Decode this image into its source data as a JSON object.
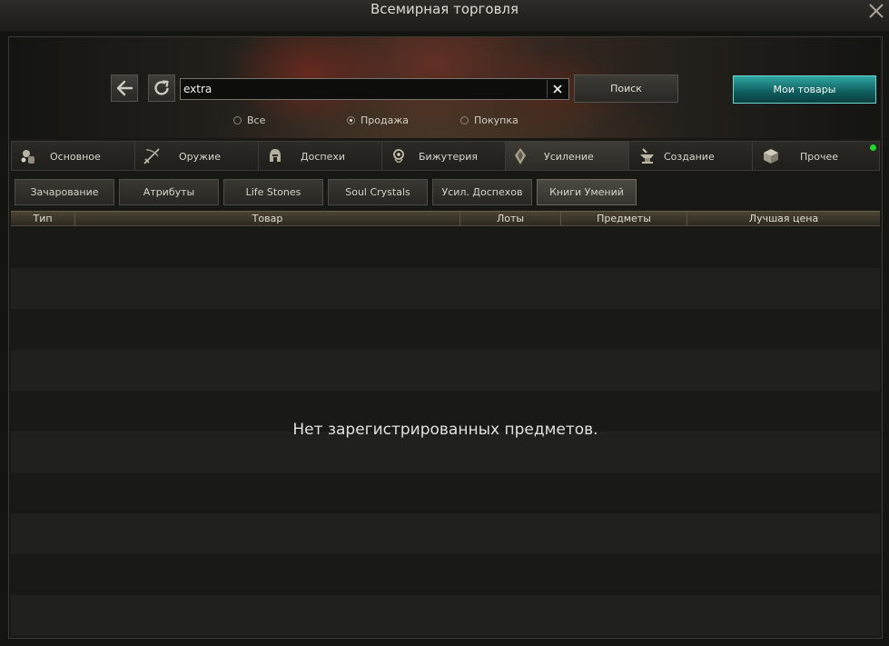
{
  "window": {
    "title": "Всемирная торговля"
  },
  "search": {
    "value": "extra",
    "button_label": "Поиск"
  },
  "my_goods_label": "Мои товары",
  "filters": [
    {
      "label": "Все",
      "selected": false
    },
    {
      "label": "Продажа",
      "selected": true
    },
    {
      "label": "Покупка",
      "selected": false
    }
  ],
  "categories": [
    {
      "label": "Основное",
      "icon": "basic-items-icon"
    },
    {
      "label": "Оружие",
      "icon": "weapon-icon"
    },
    {
      "label": "Доспехи",
      "icon": "armor-helmet-icon"
    },
    {
      "label": "Бижутерия",
      "icon": "jewelry-icon"
    },
    {
      "label": "Усиление",
      "icon": "enhancement-crystal-icon",
      "active": true
    },
    {
      "label": "Создание",
      "icon": "crafting-anvil-icon"
    },
    {
      "label": "Прочее",
      "icon": "misc-box-icon"
    }
  ],
  "subcategories": [
    {
      "label": "Зачарование"
    },
    {
      "label": "Атрибуты"
    },
    {
      "label": "Life Stones"
    },
    {
      "label": "Soul Crystals"
    },
    {
      "label": "Усил. Доспехов"
    },
    {
      "label": "Книги Умений",
      "active": true
    }
  ],
  "table": {
    "columns": [
      "Тип",
      "Товар",
      "Лоты",
      "Предметы",
      "Лучшая цена"
    ],
    "empty_message": "Нет зарегистрированных предметов."
  },
  "colors": {
    "accent_teal": "#1f8a88",
    "online_indicator": "#1fd92a",
    "header_bar": "#4b4232"
  }
}
